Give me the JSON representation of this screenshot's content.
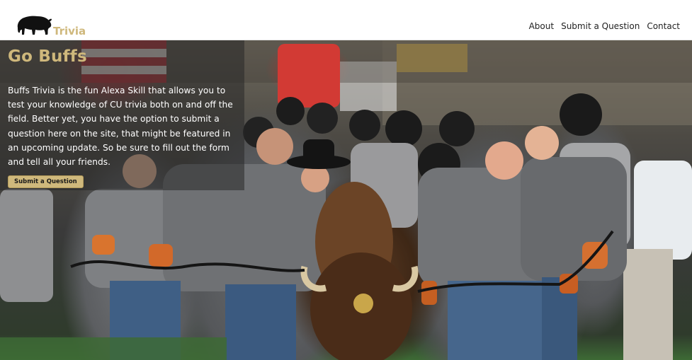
{
  "navbar": {
    "logo_icon": "buffalo-icon",
    "brand_text": "Trivia",
    "links": [
      {
        "label": "About"
      },
      {
        "label": "Submit a Question"
      },
      {
        "label": "Contact"
      }
    ]
  },
  "hero": {
    "title": "Go Buffs",
    "text": "Buffs Trivia is the fun Alexa Skill that allows you to test your knowledge of CU trivia both on and off the field. Better yet, you have the option to submit a question here on the site, that might be featured in an upcoming update. So be sure to fill out the form and tell all your friends.",
    "button_label": "Submit a Question"
  },
  "colors": {
    "brand_gold": "#cfb87c",
    "nav_text": "#222222",
    "panel_overlay": "rgba(40,40,40,0.55)"
  }
}
